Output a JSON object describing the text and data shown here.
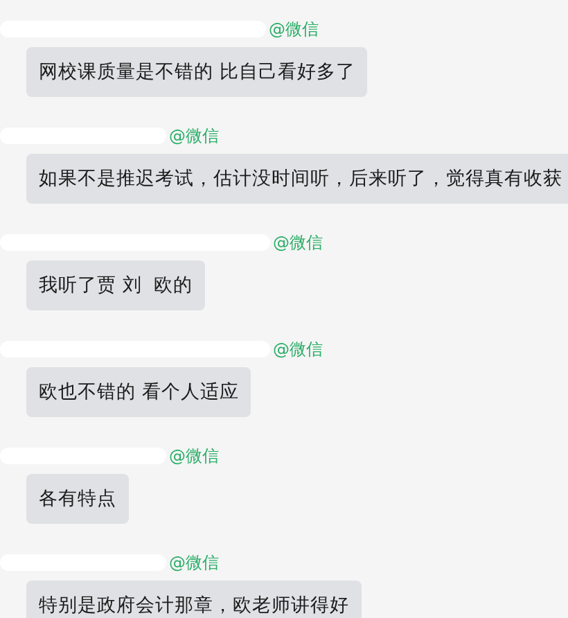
{
  "messages": [
    {
      "sender_tag": "@微信",
      "text": "网校课质量是不错的 比自己看好多了"
    },
    {
      "sender_tag": "@微信",
      "text": "如果不是推迟考试，估计没时间听，后来听了，觉得真有收获"
    },
    {
      "sender_tag": "@微信",
      "text": "我听了贾 刘  欧的"
    },
    {
      "sender_tag": "@微信",
      "text": "欧也不错的 看个人适应"
    },
    {
      "sender_tag": "@微信",
      "text": "各有特点"
    },
    {
      "sender_tag": "@微信",
      "text": "特别是政府会计那章，欧老师讲得好"
    }
  ]
}
